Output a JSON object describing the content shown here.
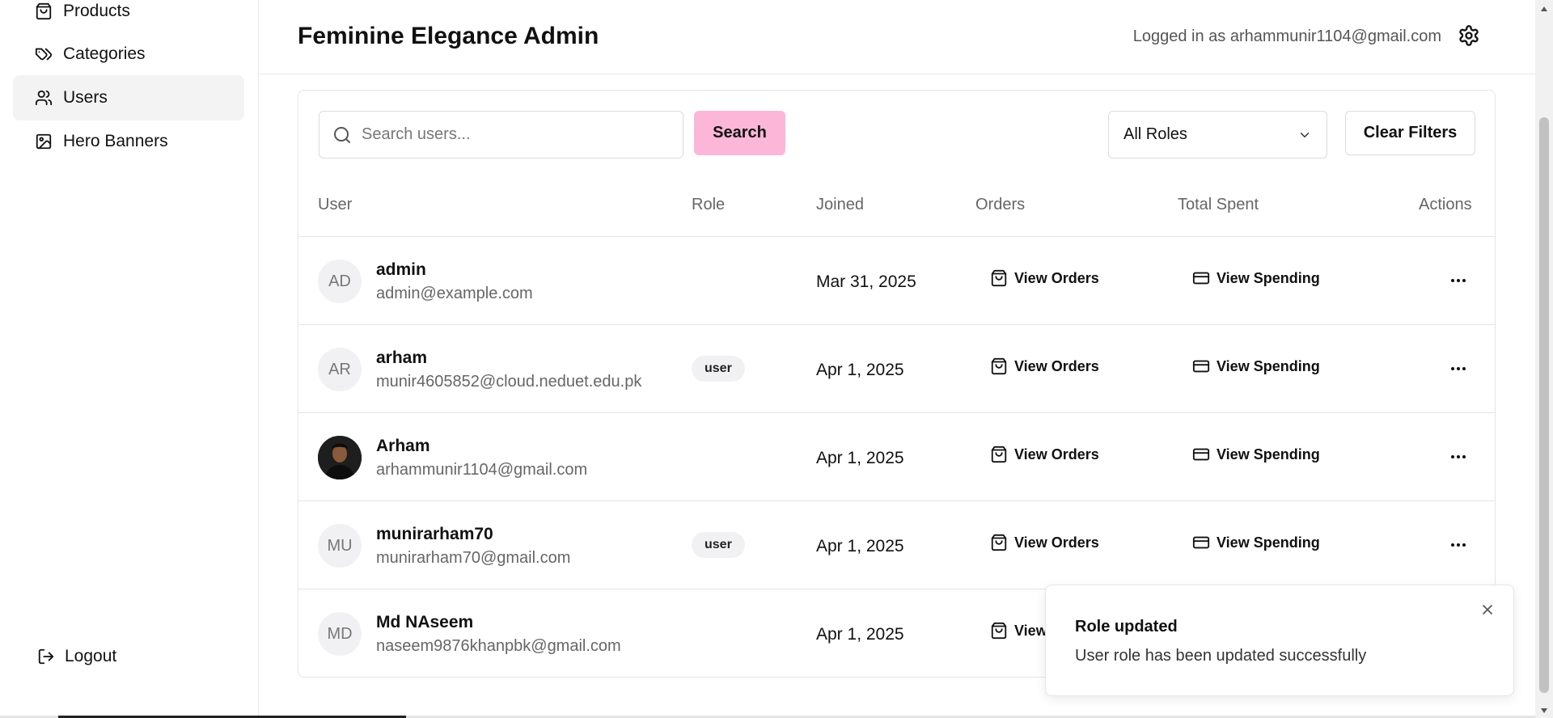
{
  "sidebar": {
    "items": [
      {
        "label": "Products",
        "icon": "shopping-bag-icon"
      },
      {
        "label": "Categories",
        "icon": "tags-icon"
      },
      {
        "label": "Users",
        "icon": "users-icon",
        "active": true
      },
      {
        "label": "Hero Banners",
        "icon": "image-icon"
      }
    ],
    "logout_label": "Logout"
  },
  "header": {
    "title": "Feminine Elegance Admin",
    "logged_in_text": "Logged in as arhammunir1104@gmail.com"
  },
  "filters": {
    "search_placeholder": "Search users...",
    "search_value": "",
    "search_button": "Search",
    "role_select": "All Roles",
    "clear_button": "Clear Filters"
  },
  "table": {
    "columns": [
      "User",
      "Role",
      "Joined",
      "Orders",
      "Total Spent",
      "Actions"
    ],
    "rows": [
      {
        "initials": "AD",
        "name": "admin",
        "email": "admin@example.com",
        "role": "",
        "joined": "Mar 31, 2025",
        "orders": "View Orders",
        "spent": "View Spending"
      },
      {
        "initials": "AR",
        "name": "arham",
        "email": "munir4605852@cloud.neduet.edu.pk",
        "role": "user",
        "joined": "Apr 1, 2025",
        "orders": "View Orders",
        "spent": "View Spending"
      },
      {
        "initials": "",
        "name": "Arham",
        "email": "arhammunir1104@gmail.com",
        "role": "",
        "joined": "Apr 1, 2025",
        "orders": "View Orders",
        "spent": "View Spending",
        "photo": true
      },
      {
        "initials": "MU",
        "name": "munirarham70",
        "email": "munirarham70@gmail.com",
        "role": "user",
        "joined": "Apr 1, 2025",
        "orders": "View Orders",
        "spent": "View Spending"
      },
      {
        "initials": "MD",
        "name": "Md NAseem",
        "email": "naseem9876khanpbk@gmail.com",
        "role": "",
        "joined": "Apr 1, 2025",
        "orders": "View",
        "spent": ""
      }
    ]
  },
  "toast": {
    "title": "Role updated",
    "message": "User role has been updated successfully"
  },
  "colors": {
    "accent": "#fbb6d8",
    "active_nav": "#f3f3f4",
    "border": "#e5e5e5"
  }
}
